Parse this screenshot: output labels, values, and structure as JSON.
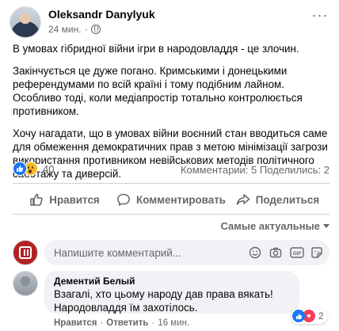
{
  "post": {
    "author": "Oleksandr Danylyuk",
    "time": "24 мин.",
    "paragraphs": [
      "В умовах гібридної війни ігри в народовладдя - це злочин.",
      "Закінчується це дуже погано. Кримськими і донецькими референдумами по всій країні і тому подібним лайном. Особливо тоді, коли медіапростір тотально контролюється противником.",
      "Хочу нагадати, що в умовах війни воєнний стан вводиться саме для обмеження демократичних прав з метою мінімізації загрози використання противником невійськових методів політичного саботажу та диверсій."
    ]
  },
  "stats": {
    "reaction_count": "40",
    "comments": "Комментарии: 5",
    "shares": "Поделились: 2"
  },
  "actions": {
    "like": "Нравится",
    "comment": "Комментировать",
    "share": "Поделиться"
  },
  "sort_label": "Самые актуальные",
  "composer": {
    "placeholder": "Напишите комментарий..."
  },
  "comment": {
    "author": "Дементий Белый",
    "line1": "Взагалі, хто цьому народу дав права вякать!",
    "line2": "Народовладдя їм захотілось.",
    "reaction_count": "2",
    "like": "Нравится",
    "reply": "Ответить",
    "time": "16 мин.",
    "sep": "·"
  },
  "colors": {
    "accent": "#1877f2",
    "text": "#050505",
    "muted": "#65676b",
    "bubble": "#f0f2f5"
  }
}
